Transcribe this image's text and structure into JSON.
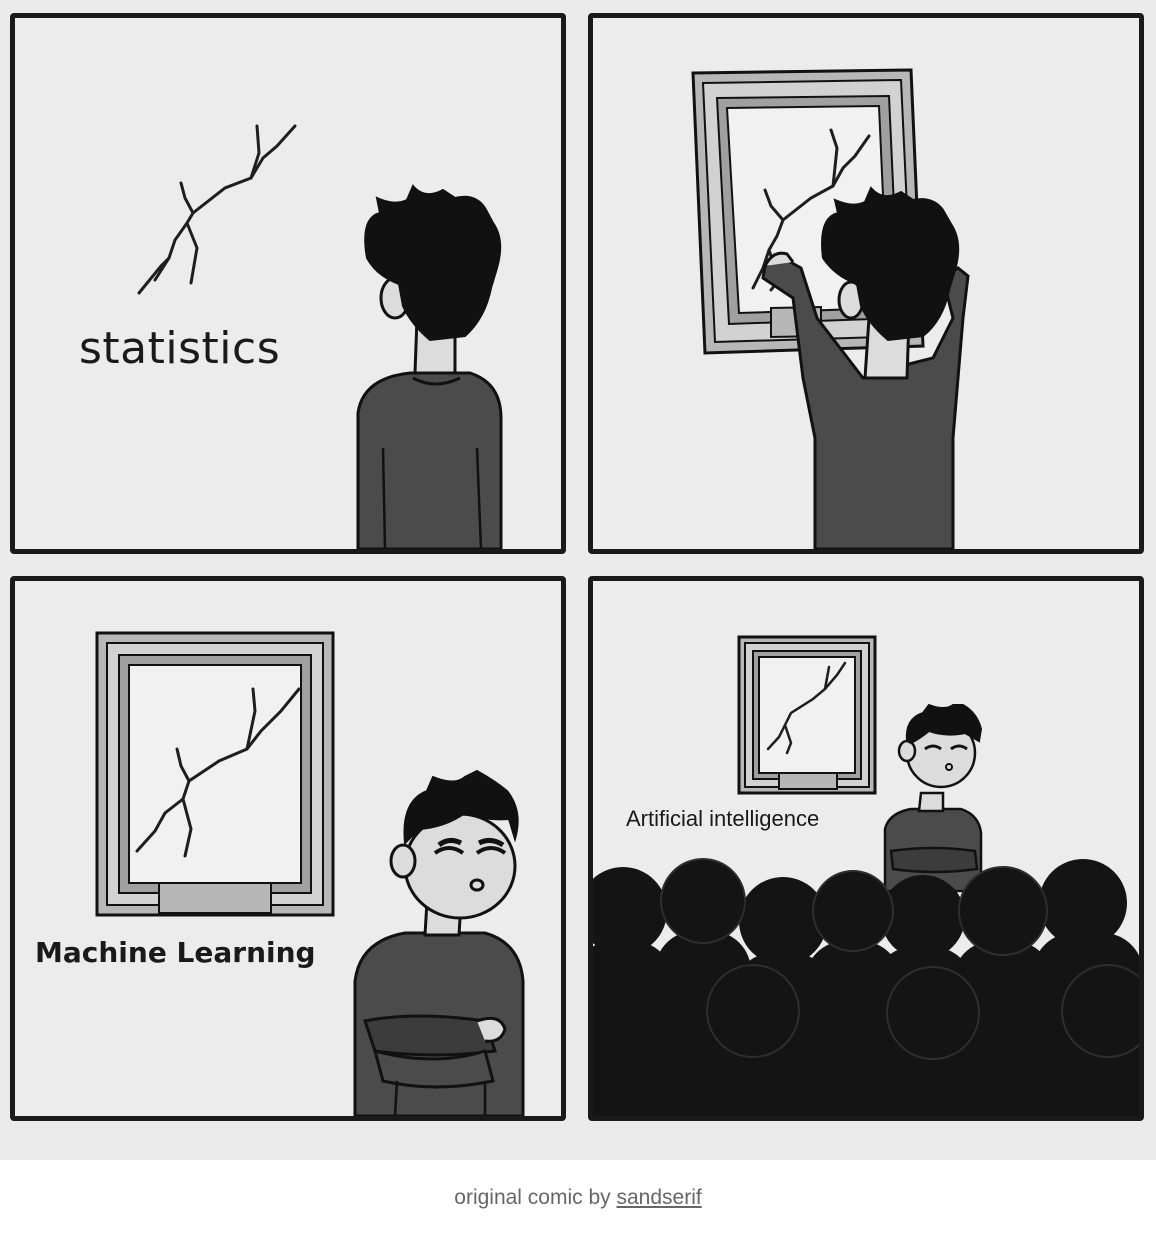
{
  "panels": {
    "panel1": {
      "label": "statistics"
    },
    "panel2": {
      "label": ""
    },
    "panel3": {
      "label": "Machine Learning"
    },
    "panel4": {
      "label": "Artificial intelligence"
    }
  },
  "caption": {
    "prefix": "original comic by ",
    "author_link": "sandserif"
  },
  "colors": {
    "background": "#ebebeb",
    "panel_border": "#1a1a1a",
    "shirt": "#4a4a4a",
    "hair": "#111111",
    "crowd": "#141414",
    "caption_text": "#666666"
  }
}
